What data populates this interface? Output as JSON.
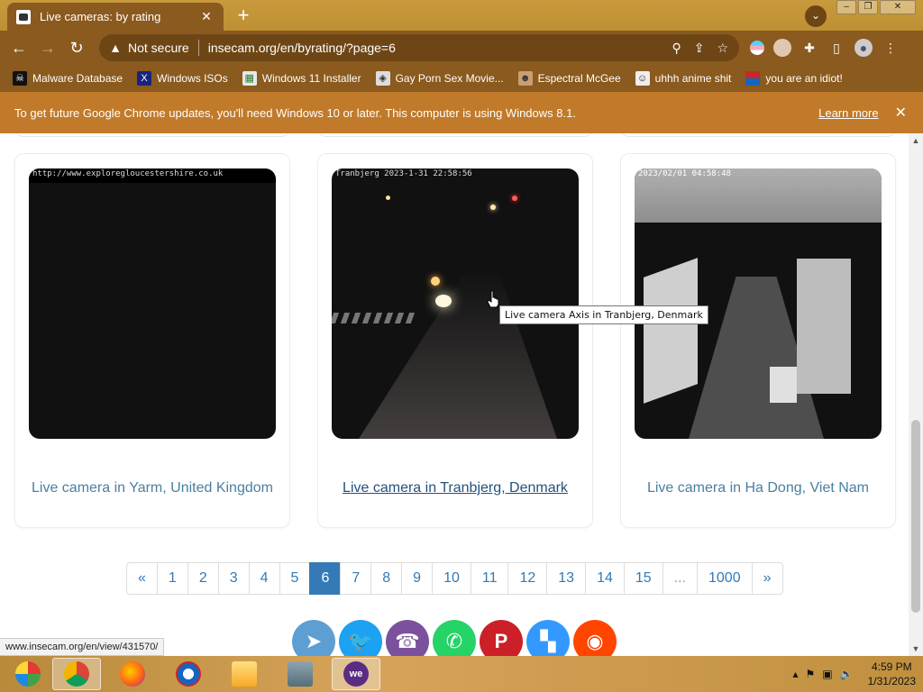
{
  "browser": {
    "tab_title": "Live cameras: by rating",
    "tab_close": "✕",
    "new_tab": "+",
    "security_label": "Not secure",
    "url": "insecam.org/en/byrating/?page=6",
    "bookmarks": [
      {
        "label": "Malware Database",
        "icon": "skull-icon"
      },
      {
        "label": "Windows ISOs",
        "icon": "x-icon"
      },
      {
        "label": "Windows 11 Installer",
        "icon": "image-icon"
      },
      {
        "label": "Gay Porn Sex Movie...",
        "icon": "favicon-icon"
      },
      {
        "label": "Espectral McGee",
        "icon": "character-icon"
      },
      {
        "label": "uhhh anime shit",
        "icon": "anime-icon"
      },
      {
        "label": "you are an idiot!",
        "icon": "flag-icon"
      }
    ]
  },
  "infobar": {
    "message": "To get future Google Chrome updates, you'll need Windows 10 or later. This computer is using Windows 8.1.",
    "link": "Learn more",
    "close": "✕"
  },
  "cameras": [
    {
      "caption": "Live camera in Yarm, United Kingdom",
      "stamp": "http://www.exploregloucestershire.co.uk"
    },
    {
      "caption": "Live camera in Tranbjerg, Denmark",
      "stamp": "Tranbjerg 2023-1-31 22:58:56"
    },
    {
      "caption": "Live camera in Ha Dong, Viet Nam",
      "stamp": "2023/02/01 04:58:48"
    }
  ],
  "tooltip": "Live camera Axis in Tranbjerg, Denmark",
  "pagination": {
    "prev": "«",
    "pages": [
      "1",
      "2",
      "3",
      "4",
      "5",
      "6",
      "7",
      "8",
      "9",
      "10",
      "11",
      "12",
      "13",
      "14",
      "15"
    ],
    "ellipsis": "...",
    "last_page": "1000",
    "next": "»",
    "current": "6"
  },
  "social": [
    {
      "name": "telegram",
      "color": "#5e9fd3",
      "glyph": "➤"
    },
    {
      "name": "twitter",
      "color": "#1da1f2",
      "glyph": "🐦"
    },
    {
      "name": "viber",
      "color": "#7b519d",
      "glyph": "☎"
    },
    {
      "name": "whatsapp",
      "color": "#25d366",
      "glyph": "✆"
    },
    {
      "name": "pinterest",
      "color": "#cb2027",
      "glyph": "P"
    },
    {
      "name": "delicious",
      "color": "#3399ff",
      "glyph": "▚"
    },
    {
      "name": "reddit",
      "color": "#ff4500",
      "glyph": "◉"
    }
  ],
  "status_url": "www.insecam.org/en/view/431570/",
  "taskbar": {
    "time": "4:59 PM",
    "date": "1/31/2023"
  },
  "colors": {
    "link": "#4a7fa0",
    "pagination_active": "#337ab7",
    "theme_tan": "#8a5a1e"
  }
}
